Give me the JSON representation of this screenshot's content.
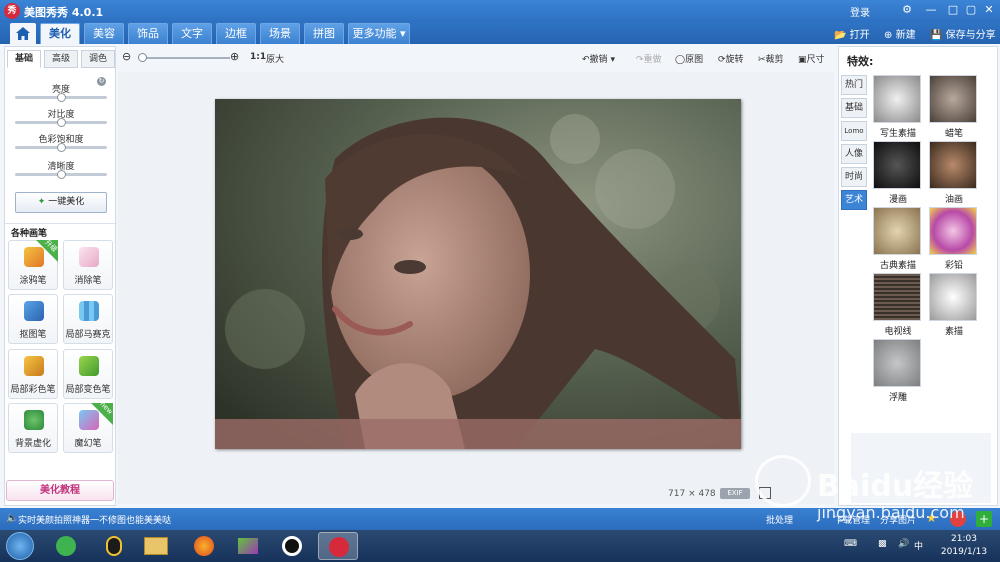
{
  "app": {
    "logo_text": "秀",
    "title": "美图秀秀 4.0.1",
    "login": "登录",
    "window_controls": [
      "minimize-icon",
      "restore-icon",
      "maximize-icon",
      "close-icon"
    ]
  },
  "nav": {
    "tabs": [
      "美化",
      "美容",
      "饰品",
      "文字",
      "边框",
      "场景",
      "拼图",
      "更多功能"
    ],
    "active": "美化",
    "actions": {
      "open": "打开",
      "new": "新建",
      "save": "保存与分享"
    }
  },
  "left": {
    "subtabs": [
      "基础",
      "高级",
      "调色"
    ],
    "sliders": {
      "brightness": "亮度",
      "contrast": "对比度",
      "saturation": "色彩饱和度",
      "sharpness": "清晰度"
    },
    "onekey": "一键美化",
    "brushes_title": "各种画笔",
    "brushes": [
      {
        "label": "涂鸦笔",
        "badge": "升级"
      },
      {
        "label": "消除笔"
      },
      {
        "label": "抠图笔"
      },
      {
        "label": "局部马赛克"
      },
      {
        "label": "局部彩色笔"
      },
      {
        "label": "局部变色笔"
      },
      {
        "label": "背景虚化"
      },
      {
        "label": "魔幻笔",
        "badge": "new"
      }
    ],
    "tutorial": "美化教程"
  },
  "toolbar": {
    "zoom_ratio": "1:1",
    "zoom_label": "原大",
    "undo": "撤销",
    "redo": "重做",
    "original": "原图",
    "rotate": "旋转",
    "crop": "裁剪",
    "resize": "尺寸"
  },
  "canvas": {
    "width": "717",
    "times": "×",
    "height": "478",
    "exif": "EXIF"
  },
  "right": {
    "title": "特效:",
    "tabs": [
      "热门",
      "基础",
      "Lomo",
      "人像",
      "时尚",
      "艺术"
    ],
    "active_tab": "艺术",
    "effects": [
      "写生素描",
      "蜡笔",
      "漫画",
      "油画",
      "古典素描",
      "彩铅",
      "电视线",
      "素描",
      "浮雕"
    ]
  },
  "status": {
    "message": "实时美颜拍照神器一不修图也能美美哒",
    "batch": "批处理",
    "download": "下载管理",
    "share": "分享图片"
  },
  "taskbar": {
    "time": "21:03",
    "date": "2019/1/13"
  },
  "watermark": {
    "brand": "Baidu经验",
    "url": "jingyan.baidu.com"
  }
}
